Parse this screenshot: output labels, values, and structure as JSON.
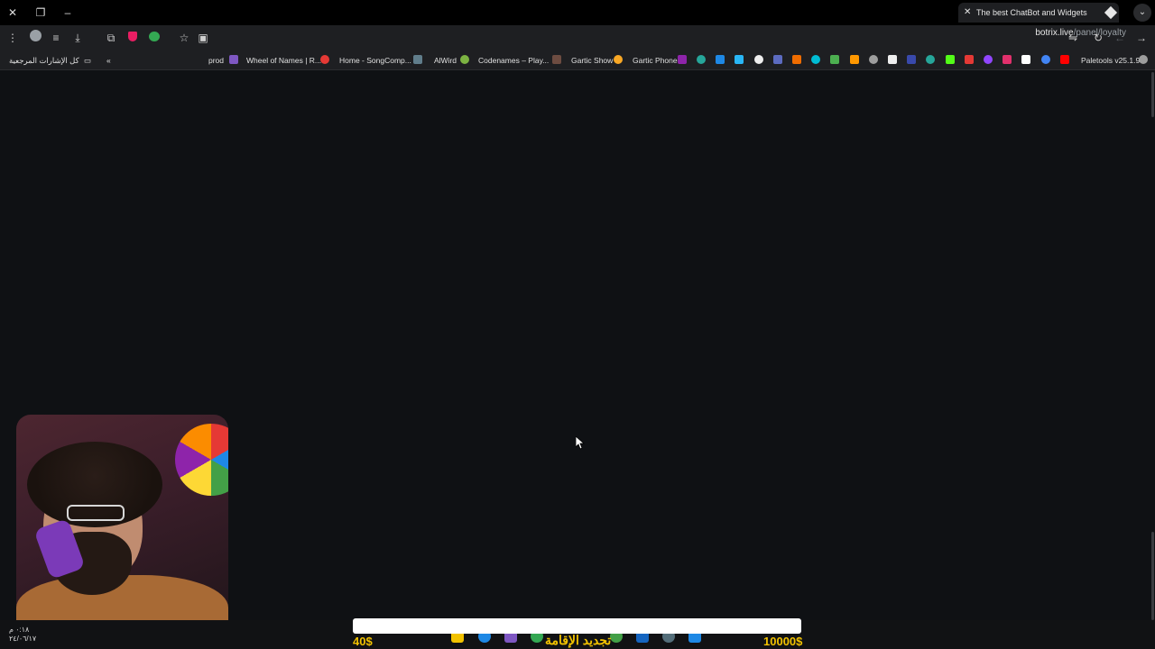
{
  "window": {
    "close_icon": "close-icon",
    "restore_icon": "restore-icon",
    "minimize_icon": "minimize-icon"
  },
  "tab": {
    "title": "The best ChatBot and Widgets",
    "new_tab_label": "+",
    "tab_menu_label": "⌄"
  },
  "toolbar": {
    "url_host": "botrix.live",
    "url_path": "/panel/loyalty",
    "icons": [
      "menu-icon",
      "profile-icon",
      "reading-list-icon",
      "download-icon",
      "extensions-icon",
      "shield-extension-icon",
      "chat-extension-icon",
      "bookmark-star-icon",
      "screen-cast-icon",
      "site-settings-icon",
      "reload-icon",
      "back-icon",
      "forward-icon"
    ]
  },
  "bookmarks": {
    "all_bookmarks": "كل الإشارات المرجعية",
    "overflow": "«",
    "items": [
      {
        "label": "prod",
        "color": "#7e57c2"
      },
      {
        "label": "Wheel of Names | R...",
        "color": "#e53935"
      },
      {
        "label": "Home - SongComp...",
        "color": "#607d8b"
      },
      {
        "label": "AlWird",
        "color": "#7cb342"
      },
      {
        "label": "Codenames – Play...",
        "color": "#6d4c41"
      },
      {
        "label": "Gartic Show",
        "color": "#f9a825"
      },
      {
        "label": "Gartic Phone",
        "color": "#8e24aa"
      },
      {
        "label": "Paletools v25.1.9",
        "color": "#9e9e9e"
      }
    ],
    "icon_only_colors": [
      "#26a69a",
      "#1e88e5",
      "#29b6f6",
      "#eeeeee",
      "#5c6bc0",
      "#ef6c00",
      "#00bcd4",
      "#4caf50",
      "#ff9800",
      "#9e9e9e",
      "#eeeeee",
      "#3949ab",
      "#26a69a",
      "#53fc18",
      "#e53935",
      "#9146ff",
      "#e1306c",
      "#ffffff",
      "#4285f4",
      "#ff0000"
    ]
  },
  "overlay": {
    "goal_title": "تجديد الإقامة",
    "goal_min": "40$",
    "goal_max": "10000$",
    "progress_fraction": 0.0,
    "clock_time": "٠:١٨ م",
    "clock_date": "٢٤/٠٦/١٧",
    "accent": "#f2c200"
  }
}
